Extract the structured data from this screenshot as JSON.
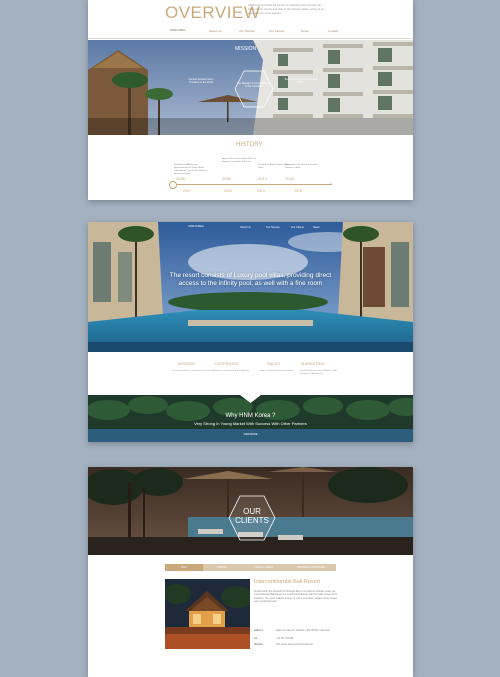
{
  "overview": {
    "title": "OVERVIEW",
    "text": "HNM Korea provides full service of marketing and promotion for luxury hotels, resorts and villas to the Korean market, acting as an extended arm of our partners.",
    "logo": "HNM KOREA",
    "nav": [
      "About Us",
      "Our Service",
      "Our Clients",
      "News",
      "Contact"
    ]
  },
  "mission": {
    "title": "MISSION",
    "left_text": "Connect Korean Luxury Travellers to the World",
    "hex_text": "The Tapestry of Luxury Gateway to the Customer",
    "right_text": "Be the Best Marketing & Sales Partner"
  },
  "history": {
    "title": "HISTORY",
    "items": [
      {
        "year": "2008",
        "text": "Established HNM Korea, Representative of Nikko Hotels International, Pan Pacific Hotels & Resorts in Korea"
      },
      {
        "year": "2009",
        "text": "Appointed as Korea Sales Office of Banyan Tree Hotels & Resorts"
      },
      {
        "year": "2013",
        "text": "Established Bali & Phuket Sales Office"
      },
      {
        "year": "2016",
        "text": "Expanded to 30 Hotels & Resorts Partners in Asia"
      }
    ],
    "years_bottom": [
      "2007",
      "2009",
      "2013",
      "2016"
    ]
  },
  "hero": {
    "nav": [
      "About Us",
      "Our Service",
      "Our Clients",
      "News",
      "Contact"
    ],
    "headline": "The resort consists of Luxury pool villas, providing direct access to the infinity pool, as well with a fine room"
  },
  "services": [
    {
      "title": "MISSION",
      "text": "Connect the Best Luxury Hotels to Korea"
    },
    {
      "title": "COOPERATE",
      "text": "Marketing Cooperation & Joint Activity"
    },
    {
      "title": "SALES",
      "text": "Sales & Promotion Representative"
    },
    {
      "title": "MARKETING",
      "text": "Digital Marketing, Social Media, Public Relations & Advertising"
    }
  ],
  "why": {
    "title": "Why HNM Korea ?",
    "subtitle": "Very Strong In Young Market With Success With Other Partners",
    "link": "VIEW MORE"
  },
  "clients": {
    "title": "OUR CLIENTS",
    "tabs": [
      "BALI",
      "PHUKET",
      "KOREA & JAPAN",
      "VIETNAM & PHILIPPINES"
    ],
    "hotel_name": "Intercontinental Bali Resort",
    "hotel_desc": "Nestled within the tranquility of Jimbaran Bay on the island's southern coast, the InterContinental Bali Resort is a beachfront hideaway with the Indian Ocean as its backdrop. The resort features a range of rooms and suites, elegant dining venues and a world class spa.",
    "info": [
      {
        "label": "Address",
        "value": "Jalan Uluwatu 45, Jimbaran, Bali 80361, Indonesia"
      },
      {
        "label": "Tel",
        "value": "+62 361 701888"
      },
      {
        "label": "Website",
        "value": "http://www.bali.intercontinental.com"
      }
    ]
  },
  "colors": {
    "accent": "#c9a87c",
    "background": "#a3b1c0"
  }
}
